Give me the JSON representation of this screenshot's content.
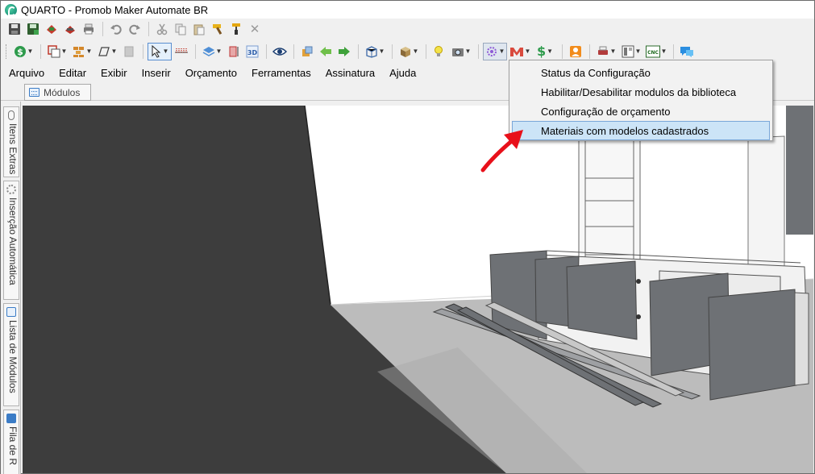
{
  "window": {
    "title": "QUARTO - Promob Maker Automate BR"
  },
  "toolbar_row1": [
    "save-icon",
    "save-all-icon",
    "render-icon",
    "render-print-icon",
    "print-icon",
    "undo-icon",
    "redo-icon",
    "cut-icon",
    "copy-icon",
    "paste-icon",
    "hammer-icon",
    "brush-icon",
    "close-icon"
  ],
  "toolbar_row2": [
    "budget-icon",
    "layout-icon",
    "bricks-icon",
    "shape-icon",
    "gray-box-icon",
    "select-icon",
    "measure-icon",
    "layers-icon",
    "dimension-icon",
    "3d-icon",
    "eye-icon",
    "move-icon",
    "arrow-left-icon",
    "arrow-right-icon",
    "box-view-icon",
    "cube-icon",
    "lightbulb-icon",
    "camera-icon",
    "plugin-icon",
    "maker-icon",
    "dollar-icon",
    "user-icon",
    "print-setup-icon",
    "panel-icon",
    "cnc-icon",
    "chat-icon"
  ],
  "toolbar": {
    "cnc_label": "CNC",
    "view3d_label": "3D"
  },
  "menu": [
    "Arquivo",
    "Editar",
    "Exibir",
    "Inserir",
    "Orçamento",
    "Ferramentas",
    "Assinatura",
    "Ajuda"
  ],
  "tabs": {
    "modulos": "Módulos"
  },
  "side_tabs": [
    "Itens Extras",
    "Inserção Automática",
    "Lista de Módulos",
    "Fila de R"
  ],
  "dropdown": {
    "items": [
      "Status da Configuração",
      "Habilitar/Desabilitar modulos da biblioteca",
      "Configuração de orçamento",
      "Materiais com modelos cadastrados"
    ],
    "highlighted_index": 3
  },
  "colors": {
    "menu_highlight": "#cce4f7",
    "annotation_arrow": "#e8101a",
    "panel_gray": "#6e7175",
    "dark_wall": "#3d3d3d"
  }
}
